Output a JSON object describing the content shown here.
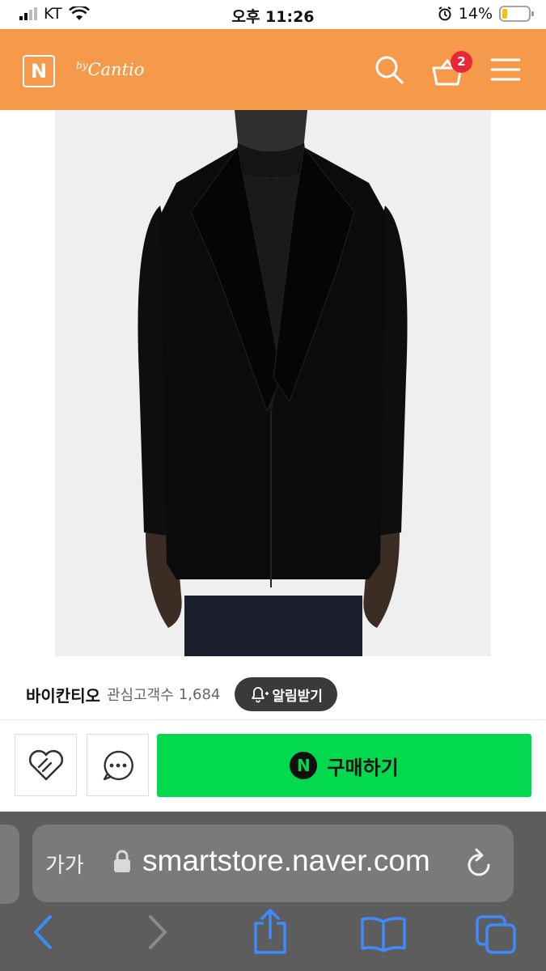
{
  "status_bar": {
    "carrier": "KT",
    "time": "오후 11:26",
    "battery": "14%"
  },
  "header": {
    "logo": "N",
    "brand_prefix": "by",
    "brand": "Cantio",
    "cart_count": "2"
  },
  "colors": {
    "header_bg": "#f5994a",
    "buy_green": "#03d94f",
    "badge_red": "#e8283a"
  },
  "shop": {
    "name": "바이칸티오",
    "favorites_label": "관심고객수",
    "favorites_count": "1,684",
    "alarm_label": "알림받기"
  },
  "actions": {
    "buy_logo": "N",
    "buy_label": "구매하기",
    "icons": [
      "heart-icon",
      "chat-icon"
    ]
  },
  "safari": {
    "text_size": "가가",
    "url": "smartstore.naver.com"
  }
}
